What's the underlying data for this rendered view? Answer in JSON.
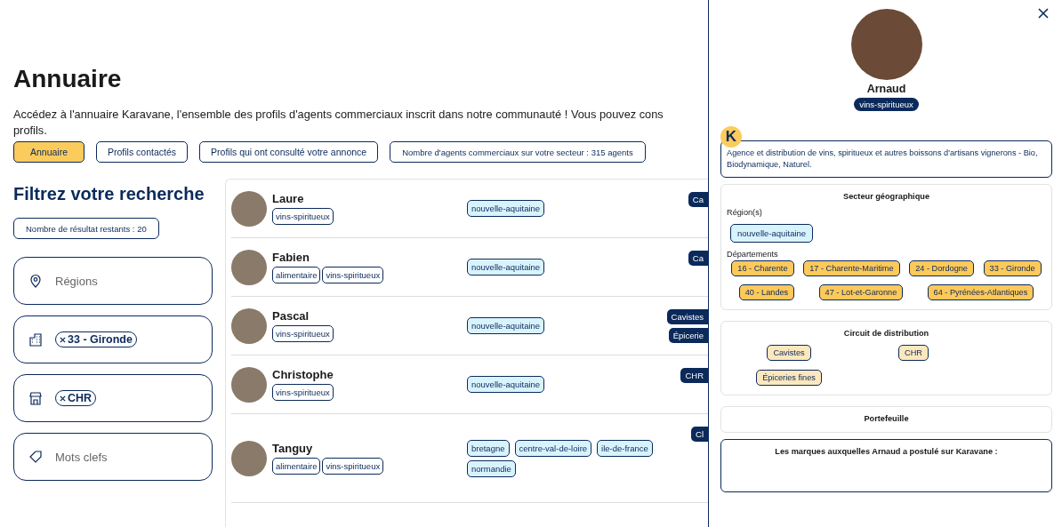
{
  "page": {
    "title": "Annuaire",
    "description": "Accédez à l'annuaire Karavane, l'ensemble des profils d'agents commerciaux inscrit dans notre communauté ! Vous pouvez cons",
    "description_cont": "profils.",
    "tabs": [
      {
        "label": "Annuaire",
        "selected": true
      },
      {
        "label": "Profils contactés",
        "selected": false
      },
      {
        "label": "Profils qui ont consulté votre annonce",
        "selected": false
      }
    ],
    "agent_count": "Nombre d'agents commerciaux sur votre secteur  : 315 agents"
  },
  "filters": {
    "title": "Filtrez votre recherche",
    "results_count": "Nombre de résultat restants : 20",
    "fields": [
      {
        "kind": "empty",
        "placeholder": "Régions"
      },
      {
        "kind": "chips",
        "chips": [
          "33 - Gironde"
        ]
      },
      {
        "kind": "chips",
        "chips": [
          "CHR"
        ]
      },
      {
        "kind": "empty",
        "placeholder": "Mots clefs"
      }
    ]
  },
  "agents": [
    {
      "name": "Laure",
      "sectors": [
        "vins-spiritueux"
      ],
      "regions": [
        "nouvelle-aquitaine"
      ],
      "channels": [
        "Ca"
      ]
    },
    {
      "name": "Fabien",
      "sectors": [
        "alimentaire",
        "vins-spiritueux"
      ],
      "regions": [
        "nouvelle-aquitaine"
      ],
      "channels": [
        "Ca"
      ]
    },
    {
      "name": "Pascal",
      "sectors": [
        "vins-spiritueux"
      ],
      "regions": [
        "nouvelle-aquitaine"
      ],
      "channels": [
        "Cavistes",
        "Épicerie"
      ]
    },
    {
      "name": "Christophe",
      "sectors": [
        "vins-spiritueux"
      ],
      "regions": [
        "nouvelle-aquitaine"
      ],
      "channels": [
        "CHR"
      ]
    },
    {
      "name": "Tanguy",
      "sectors": [
        "alimentaire",
        "vins-spiritueux"
      ],
      "regions": [
        "bretagne",
        "centre-val-de-loire",
        "ile-de-france",
        "normandie"
      ],
      "channels": [
        "Cl"
      ]
    }
  ],
  "drawer": {
    "name": "Arnaud",
    "sector": "vins-spiritueux",
    "logo_letter": "K",
    "description": "Agence et distribution de vins, spiritueux et autres boissons d'artisans vignerons - Bio, Biodynamique, Naturel.",
    "geo": {
      "title": "Secteur géographique",
      "regions_label": "Région(s)",
      "regions": [
        "nouvelle-aquitaine"
      ],
      "departments_label": "Départements",
      "departments": [
        "16 - Charente",
        "17 - Charente-Maritime",
        "24 - Dordogne",
        "33 - Gironde",
        "40 - Landes",
        "47 - Lot-et-Garonne",
        "64 - Pyrénées-Atlantiques"
      ]
    },
    "distribution": {
      "title": "Circuit de distribution",
      "channels": [
        "Cavistes",
        "CHR",
        "Épiceries fines"
      ]
    },
    "portfolio": {
      "title": "Portefeuille"
    },
    "brands": {
      "title": "Les marques auxquelles Arnaud a postulé sur Karavane :"
    }
  }
}
